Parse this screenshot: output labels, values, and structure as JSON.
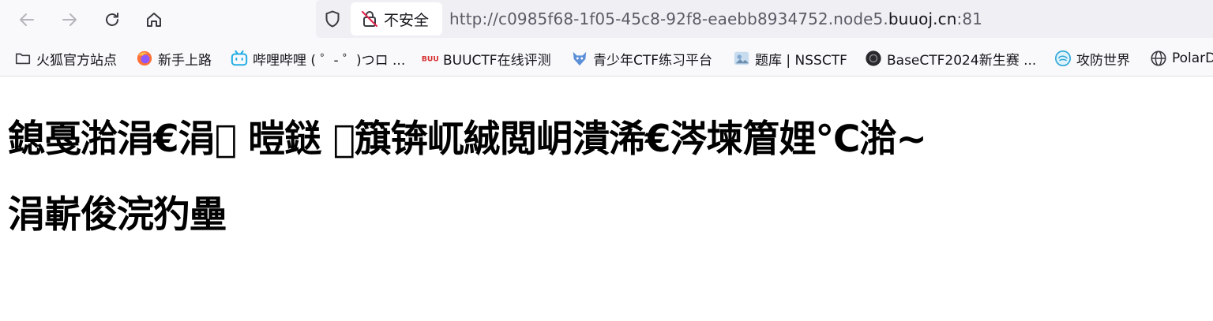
{
  "toolbar": {
    "insecure_label": "不安全",
    "url_prefix": "http://c0985f68-1f05-45c8-92f8-eaebb8934752.node5.",
    "url_domain": "buuoj.cn",
    "url_suffix": ":81"
  },
  "bookmarks": [
    {
      "label": "火狐官方站点",
      "icon": "folder-icon"
    },
    {
      "label": "新手上路",
      "icon": "firefox-icon"
    },
    {
      "label": "哔哩哔哩 ( ゜- ゜)つロ ...",
      "icon": "bilibili-icon"
    },
    {
      "label": "BUUCTF在线评测",
      "icon": "buuctf-icon"
    },
    {
      "label": "青少年CTF练习平台",
      "icon": "fox-mascot-icon"
    },
    {
      "label": "题库 | NSSCTF",
      "icon": "nssctf-icon"
    },
    {
      "label": "BaseCTF2024新生赛 ...",
      "icon": "basectf-icon"
    },
    {
      "label": "攻防世界",
      "icon": "globe-swirl-icon"
    },
    {
      "label": "PolarD",
      "icon": "globe-icon"
    }
  ],
  "page": {
    "heading1": "鎴戞湁涓€涓\u0000 暟鎹 \u0000簱锛屼絾閲岄潰浠€涔堜篃娌℃湁~",
    "heading2": "涓嶄俊浣犳壘"
  }
}
